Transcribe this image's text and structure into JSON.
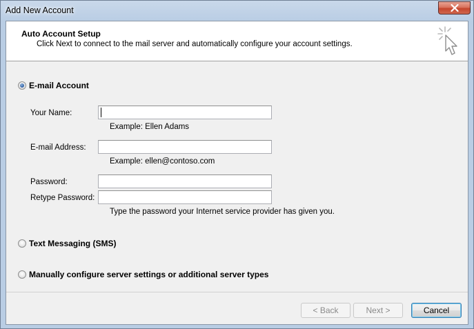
{
  "window": {
    "title": "Add New Account"
  },
  "header": {
    "title": "Auto Account Setup",
    "subtitle": "Click Next to connect to the mail server and automatically configure your account settings.",
    "icon": "cursor-click-icon"
  },
  "options": {
    "email": {
      "label": "E-mail Account",
      "selected": true
    },
    "sms": {
      "label": "Text Messaging (SMS)",
      "selected": false
    },
    "manual": {
      "label": "Manually configure server settings or additional server types",
      "selected": false
    }
  },
  "form": {
    "name": {
      "label": "Your Name:",
      "value": "",
      "hint": "Example: Ellen Adams"
    },
    "email": {
      "label": "E-mail Address:",
      "value": "",
      "hint": "Example: ellen@contoso.com"
    },
    "password": {
      "label": "Password:",
      "value": ""
    },
    "retype": {
      "label": "Retype Password:",
      "value": "",
      "hint": "Type the password your Internet service provider has given you."
    }
  },
  "buttons": {
    "back": "< Back",
    "next": "Next >",
    "cancel": "Cancel"
  },
  "colors": {
    "close_button": "#c5452d",
    "radio_selected": "#2c5c9f",
    "default_button_border": "#3c7fb1"
  }
}
